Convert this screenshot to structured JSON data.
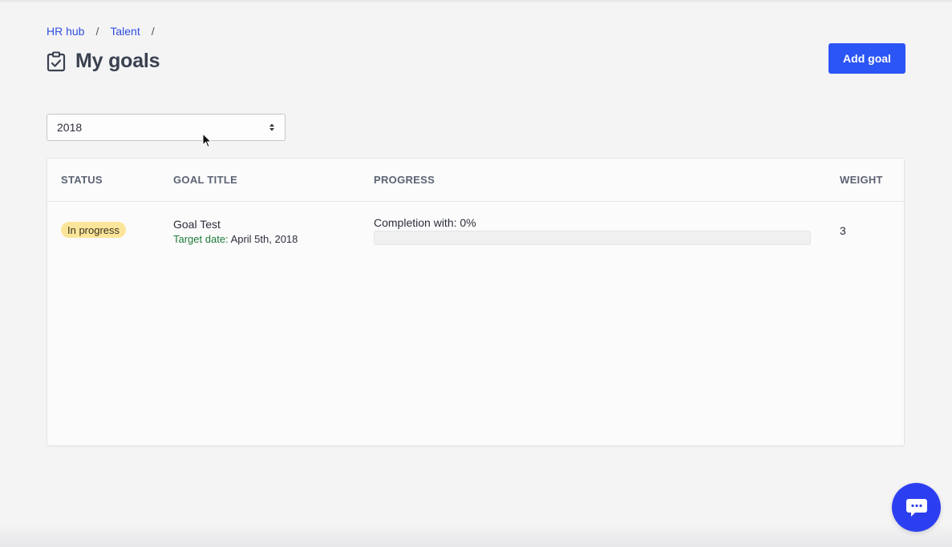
{
  "breadcrumb": {
    "items": [
      "HR hub",
      "Talent"
    ],
    "separator": "/"
  },
  "page": {
    "title": "My goals",
    "title_icon": "clipboard-check-icon"
  },
  "actions": {
    "add_goal_label": "Add goal"
  },
  "filter": {
    "year_selected": "2018"
  },
  "table": {
    "headers": {
      "status": "STATUS",
      "goal_title": "GOAL TITLE",
      "progress": "PROGRESS",
      "weight": "WEIGHT"
    },
    "rows": [
      {
        "status": "In progress",
        "title": "Goal Test",
        "target_label": "Target date:",
        "target_date": "April 5th, 2018",
        "completion_text": "Completion with: 0%",
        "completion_value": 0,
        "weight": "3"
      }
    ]
  },
  "chat": {
    "icon": "chat-bubble-icon"
  },
  "colors": {
    "primary": "#2c55f5",
    "link": "#2f4fe0",
    "status_in_progress": "#fbe59a",
    "target_label": "#1f7a3a",
    "chat": "#2c3ff0"
  }
}
